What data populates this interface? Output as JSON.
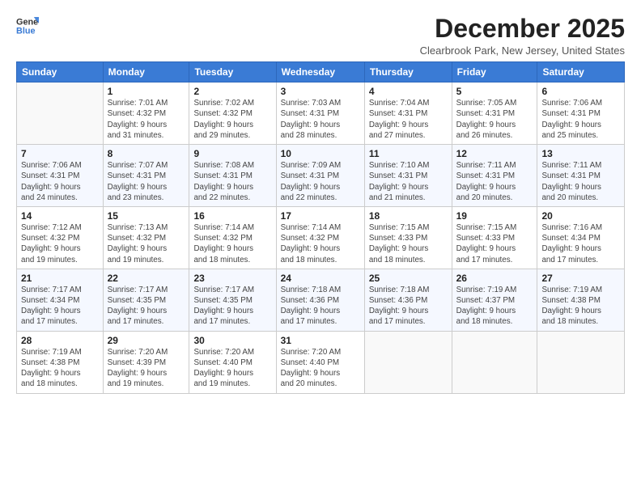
{
  "logo": {
    "line1": "General",
    "line2": "Blue"
  },
  "title": "December 2025",
  "location": "Clearbrook Park, New Jersey, United States",
  "days_header": [
    "Sunday",
    "Monday",
    "Tuesday",
    "Wednesday",
    "Thursday",
    "Friday",
    "Saturday"
  ],
  "weeks": [
    [
      {
        "day": "",
        "info": ""
      },
      {
        "day": "1",
        "info": "Sunrise: 7:01 AM\nSunset: 4:32 PM\nDaylight: 9 hours\nand 31 minutes."
      },
      {
        "day": "2",
        "info": "Sunrise: 7:02 AM\nSunset: 4:32 PM\nDaylight: 9 hours\nand 29 minutes."
      },
      {
        "day": "3",
        "info": "Sunrise: 7:03 AM\nSunset: 4:31 PM\nDaylight: 9 hours\nand 28 minutes."
      },
      {
        "day": "4",
        "info": "Sunrise: 7:04 AM\nSunset: 4:31 PM\nDaylight: 9 hours\nand 27 minutes."
      },
      {
        "day": "5",
        "info": "Sunrise: 7:05 AM\nSunset: 4:31 PM\nDaylight: 9 hours\nand 26 minutes."
      },
      {
        "day": "6",
        "info": "Sunrise: 7:06 AM\nSunset: 4:31 PM\nDaylight: 9 hours\nand 25 minutes."
      }
    ],
    [
      {
        "day": "7",
        "info": "Sunrise: 7:06 AM\nSunset: 4:31 PM\nDaylight: 9 hours\nand 24 minutes."
      },
      {
        "day": "8",
        "info": "Sunrise: 7:07 AM\nSunset: 4:31 PM\nDaylight: 9 hours\nand 23 minutes."
      },
      {
        "day": "9",
        "info": "Sunrise: 7:08 AM\nSunset: 4:31 PM\nDaylight: 9 hours\nand 22 minutes."
      },
      {
        "day": "10",
        "info": "Sunrise: 7:09 AM\nSunset: 4:31 PM\nDaylight: 9 hours\nand 22 minutes."
      },
      {
        "day": "11",
        "info": "Sunrise: 7:10 AM\nSunset: 4:31 PM\nDaylight: 9 hours\nand 21 minutes."
      },
      {
        "day": "12",
        "info": "Sunrise: 7:11 AM\nSunset: 4:31 PM\nDaylight: 9 hours\nand 20 minutes."
      },
      {
        "day": "13",
        "info": "Sunrise: 7:11 AM\nSunset: 4:31 PM\nDaylight: 9 hours\nand 20 minutes."
      }
    ],
    [
      {
        "day": "14",
        "info": "Sunrise: 7:12 AM\nSunset: 4:32 PM\nDaylight: 9 hours\nand 19 minutes."
      },
      {
        "day": "15",
        "info": "Sunrise: 7:13 AM\nSunset: 4:32 PM\nDaylight: 9 hours\nand 19 minutes."
      },
      {
        "day": "16",
        "info": "Sunrise: 7:14 AM\nSunset: 4:32 PM\nDaylight: 9 hours\nand 18 minutes."
      },
      {
        "day": "17",
        "info": "Sunrise: 7:14 AM\nSunset: 4:32 PM\nDaylight: 9 hours\nand 18 minutes."
      },
      {
        "day": "18",
        "info": "Sunrise: 7:15 AM\nSunset: 4:33 PM\nDaylight: 9 hours\nand 18 minutes."
      },
      {
        "day": "19",
        "info": "Sunrise: 7:15 AM\nSunset: 4:33 PM\nDaylight: 9 hours\nand 17 minutes."
      },
      {
        "day": "20",
        "info": "Sunrise: 7:16 AM\nSunset: 4:34 PM\nDaylight: 9 hours\nand 17 minutes."
      }
    ],
    [
      {
        "day": "21",
        "info": "Sunrise: 7:17 AM\nSunset: 4:34 PM\nDaylight: 9 hours\nand 17 minutes."
      },
      {
        "day": "22",
        "info": "Sunrise: 7:17 AM\nSunset: 4:35 PM\nDaylight: 9 hours\nand 17 minutes."
      },
      {
        "day": "23",
        "info": "Sunrise: 7:17 AM\nSunset: 4:35 PM\nDaylight: 9 hours\nand 17 minutes."
      },
      {
        "day": "24",
        "info": "Sunrise: 7:18 AM\nSunset: 4:36 PM\nDaylight: 9 hours\nand 17 minutes."
      },
      {
        "day": "25",
        "info": "Sunrise: 7:18 AM\nSunset: 4:36 PM\nDaylight: 9 hours\nand 17 minutes."
      },
      {
        "day": "26",
        "info": "Sunrise: 7:19 AM\nSunset: 4:37 PM\nDaylight: 9 hours\nand 18 minutes."
      },
      {
        "day": "27",
        "info": "Sunrise: 7:19 AM\nSunset: 4:38 PM\nDaylight: 9 hours\nand 18 minutes."
      }
    ],
    [
      {
        "day": "28",
        "info": "Sunrise: 7:19 AM\nSunset: 4:38 PM\nDaylight: 9 hours\nand 18 minutes."
      },
      {
        "day": "29",
        "info": "Sunrise: 7:20 AM\nSunset: 4:39 PM\nDaylight: 9 hours\nand 19 minutes."
      },
      {
        "day": "30",
        "info": "Sunrise: 7:20 AM\nSunset: 4:40 PM\nDaylight: 9 hours\nand 19 minutes."
      },
      {
        "day": "31",
        "info": "Sunrise: 7:20 AM\nSunset: 4:40 PM\nDaylight: 9 hours\nand 20 minutes."
      },
      {
        "day": "",
        "info": ""
      },
      {
        "day": "",
        "info": ""
      },
      {
        "day": "",
        "info": ""
      }
    ]
  ]
}
